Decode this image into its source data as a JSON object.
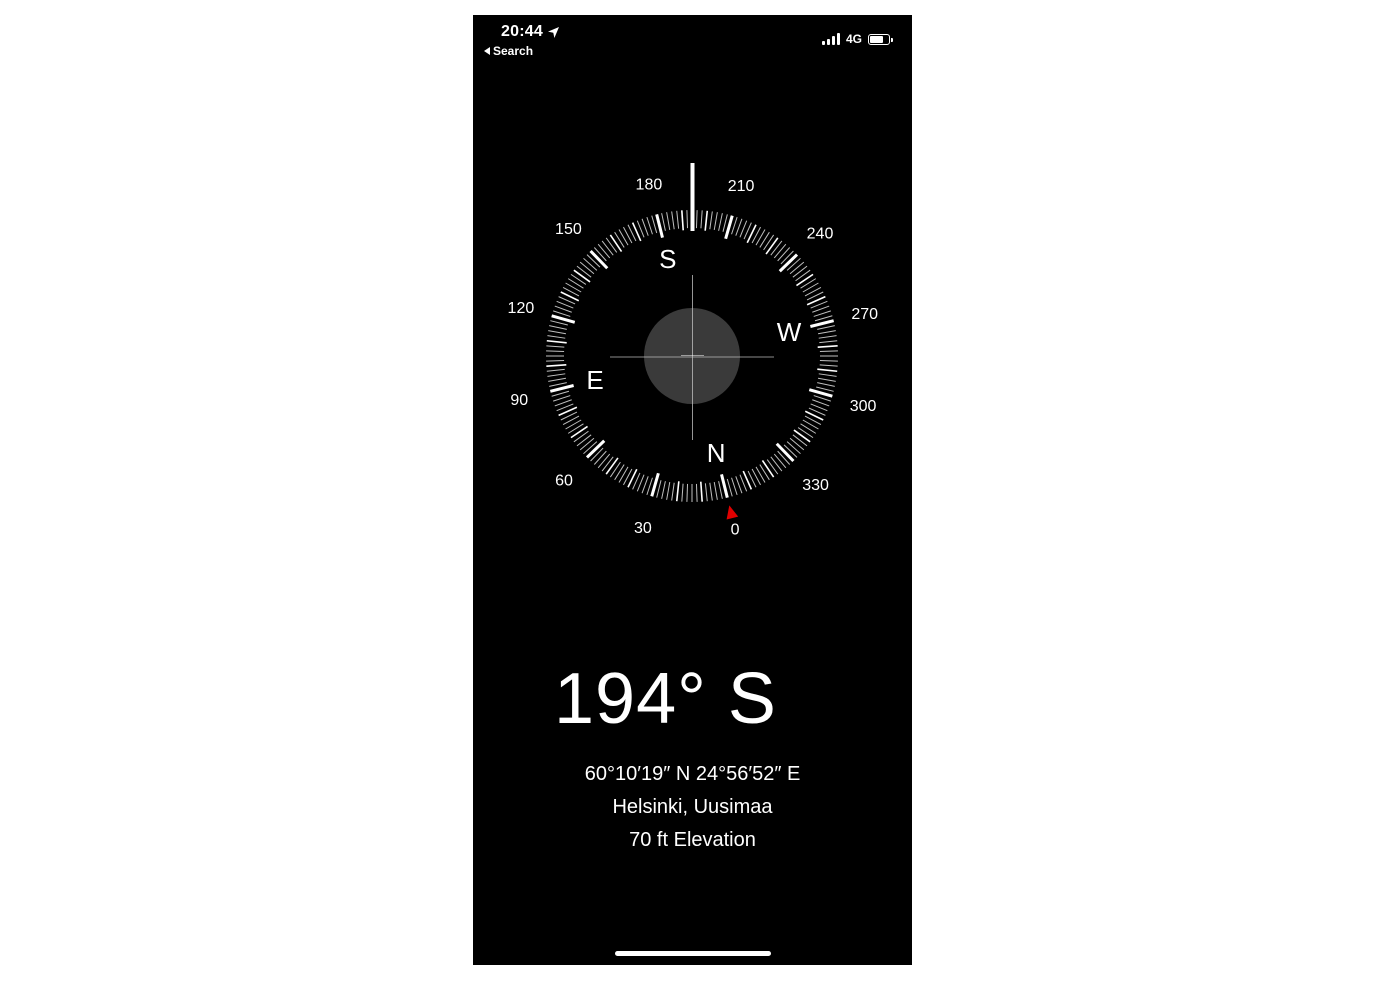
{
  "status_bar": {
    "time": "20:44",
    "back_label": "Search",
    "network": "4G",
    "battery_level": 0.75
  },
  "compass": {
    "heading_deg": 194,
    "degree_labels": [
      "0",
      "30",
      "60",
      "90",
      "120",
      "150",
      "180",
      "210",
      "240",
      "270",
      "300",
      "330"
    ],
    "cardinals": {
      "north": "N",
      "east": "E",
      "south": "S",
      "west": "W"
    }
  },
  "readout": {
    "heading_text": "194° S",
    "coordinates": "60°10′19″ N  24°56′52″ E",
    "location": "Helsinki, Uusimaa",
    "elevation": "70 ft Elevation"
  },
  "colors": {
    "background": "#000000",
    "foreground": "#ffffff",
    "north_marker": "#e00000"
  }
}
